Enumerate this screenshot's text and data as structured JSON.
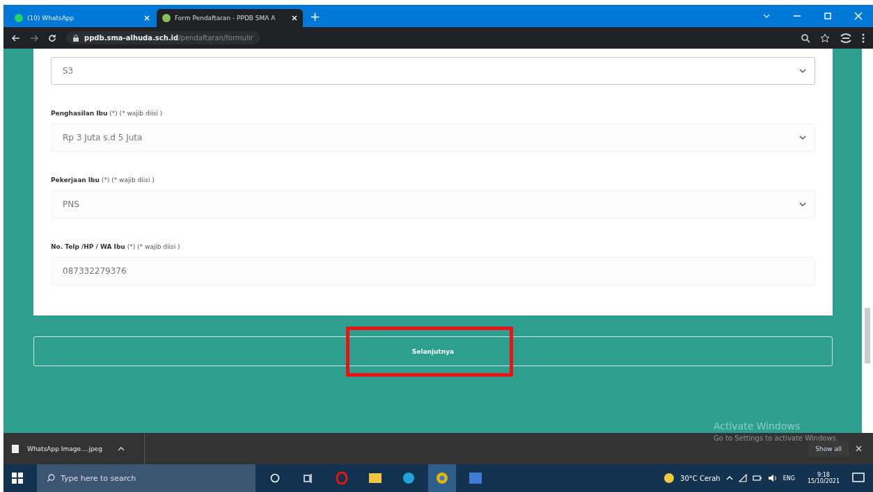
{
  "browser": {
    "tabs": [
      {
        "title": "(10) WhatsApp",
        "selected": false
      },
      {
        "title": "Form Pendaftaran - PPDB SMA A",
        "selected": true
      }
    ],
    "new_tab": "+",
    "url_host": "ppdb.sma-alhuda.sch.id",
    "url_path": "/pendaftaran/formulir"
  },
  "form": {
    "fields": [
      {
        "kind": "select",
        "value": "S3",
        "focused": true
      },
      {
        "kind": "select",
        "label": "Penghasilan Ibu",
        "required": "(*)",
        "hint": "(* wajib diisi )",
        "value": "Rp 3 Juta s.d 5 Juta",
        "focused": false
      },
      {
        "kind": "select",
        "label": "Pekerjaan Ibu",
        "required": "(*)",
        "hint": "(* wajib diisi )",
        "value": "PNS",
        "focused": false
      },
      {
        "kind": "input",
        "label": "No. Telp /HP / WA Ibu",
        "required": "(*)",
        "hint": "(* wajib diisi )",
        "value": "087332279376",
        "focused": false
      }
    ],
    "next_button": {
      "label": "Selanjutnya",
      "highlighted": true
    }
  },
  "activation_notice": {
    "title": "Activate Windows",
    "text": "Go to Settings to activate Windows."
  },
  "download_bar": {
    "file": "WhatsApp Image....jpeg",
    "show_all": "Show all"
  },
  "taskbar": {
    "search_placeholder": "Type here to search",
    "weather": "30°C  Cerah",
    "language": "ENG",
    "time": "9:18",
    "date": "15/10/2021"
  }
}
